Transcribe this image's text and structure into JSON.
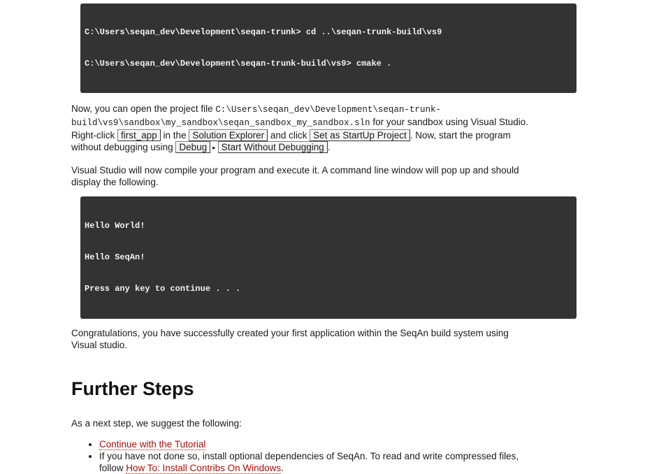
{
  "code_block_1": {
    "lines": [
      "C:\\Users\\seqan_dev\\Development\\seqan-trunk> cd ..\\seqan-trunk-build\\vs9",
      "C:\\Users\\seqan_dev\\Development\\seqan-trunk-build\\vs9> cmake ."
    ]
  },
  "para_open": {
    "t1": "Now, you can open the project file ",
    "path_line1": "C:\\Users\\seqan_dev\\Development\\seqan-trunk-",
    "path_line2": "build\\vs9\\sandbox\\my_sandbox\\seqan_sandbox_my_sandbox.sln",
    "t2": " for your sandbox using Visual Studio.",
    "t3": "Right-click ",
    "gui_first_app": "first_app",
    "t4": " in the ",
    "gui_solution_explorer": "Solution Explorer",
    "t5": " and click ",
    "gui_set_startup": "Set as StartUp Project",
    "t6": ". Now, start the program",
    "t7": "without debugging using ",
    "gui_debug": "Debug",
    "menu_arrow": "▸",
    "gui_start_without": "Start Without Debugging",
    "t8": "."
  },
  "para_compile": {
    "line1": "Visual Studio will now compile your program and execute it. A command line window will pop up and should",
    "line2": "display the following."
  },
  "code_block_2": {
    "lines": [
      "Hello World!",
      "Hello SeqAn!",
      "Press any key to continue . . ."
    ]
  },
  "para_congrats": {
    "line1": "Congratulations, you have successfully created your first application within the SeqAn build system using",
    "line2": "Visual studio."
  },
  "heading_further": "Further Steps",
  "para_next": "As a next step, we suggest the following:",
  "list": {
    "item1_link": "Continue with the Tutorial",
    "item2_text_line1": "If you have not done so, install optional dependencies of SeqAn. To read and write compressed files,",
    "item2_text_prefix": "follow ",
    "item2_link": "How To: Install Contribs On Windows",
    "item2_suffix": "."
  }
}
